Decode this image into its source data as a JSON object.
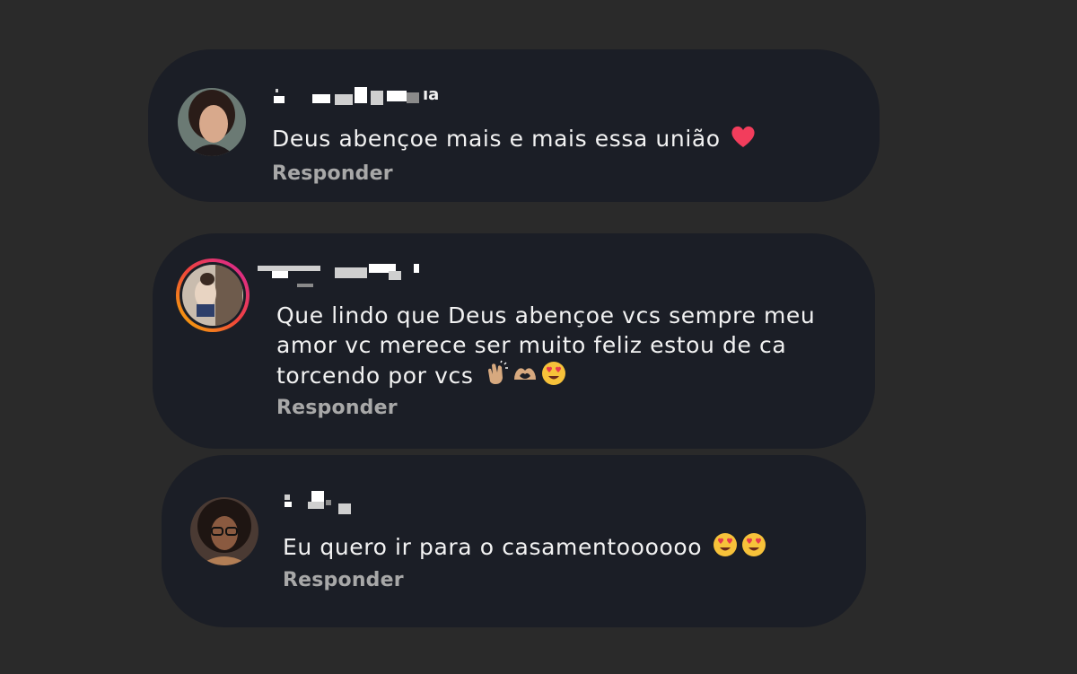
{
  "comments": [
    {
      "username": "ıa",
      "text": "Deus abençoe mais e mais essa união",
      "emoji": [
        "red-heart"
      ],
      "reply_label": "Responder"
    },
    {
      "username": "",
      "text": "Que lindo que Deus abençoe vcs sempre meu amor vc merece ser muito feliz estou de ca torcendo por vcs",
      "emoji": [
        "clapping-hands",
        "heart-hands",
        "heart-eyes-face"
      ],
      "reply_label": "Responder"
    },
    {
      "username": "",
      "text": "Eu quero ir para o casamentoooooo",
      "emoji": [
        "heart-eyes-face",
        "heart-eyes-face"
      ],
      "reply_label": "Responder"
    }
  ],
  "colors": {
    "background": "#2a2a2a",
    "card": "#1b1e26",
    "text": "#f2f2f2",
    "reply": "#a8a8a8",
    "story_ring_start": "#f5b400",
    "story_ring_end": "#d6249f"
  }
}
